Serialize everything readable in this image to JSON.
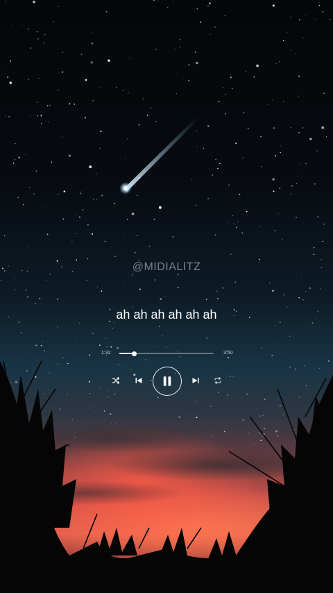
{
  "overlay": {
    "watermark": "@MIDIALITZ",
    "lyric": "ah ah ah ah ah ah"
  },
  "player": {
    "current_time": "1:32",
    "total_time": "3:50",
    "progress_fraction": 0.16,
    "state": "playing",
    "controls": {
      "shuffle_icon": "shuffle-icon",
      "previous_icon": "skip-previous-icon",
      "play_pause_icon": "pause-icon",
      "next_icon": "skip-next-icon",
      "repeat_icon": "repeat-icon"
    }
  },
  "colors": {
    "text": "#ffffff",
    "track": "#c8cdd7",
    "sunset": "#e8604e"
  }
}
